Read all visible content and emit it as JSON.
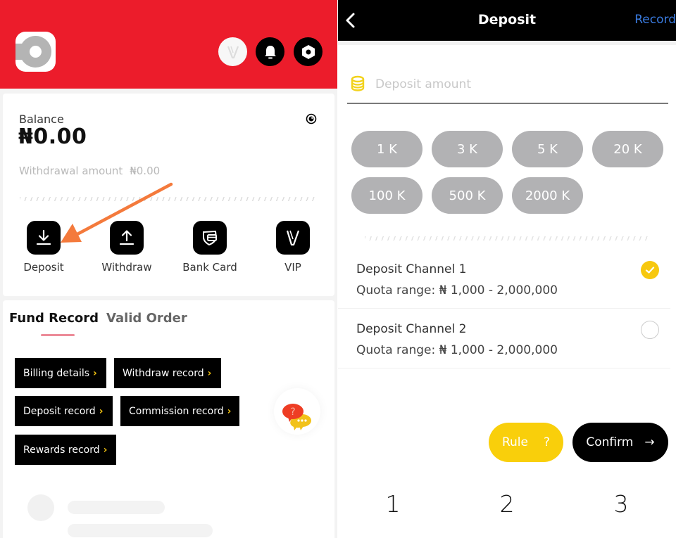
{
  "left_panel": {
    "header": {
      "icons": [
        "app-logo-icon",
        "vip-icon",
        "bell-icon",
        "settings-icon"
      ]
    },
    "balance": {
      "label": "Balance",
      "value": "₦0.00",
      "withdrawal_label": "Withdrawal amount",
      "withdrawal_value": "₦0.00"
    },
    "actions": [
      {
        "label": "Deposit",
        "icon": "download-icon"
      },
      {
        "label": "Withdraw",
        "icon": "upload-icon"
      },
      {
        "label": "Bank Card",
        "icon": "bank-card-icon"
      },
      {
        "label": "VIP",
        "icon": "vip-icon"
      }
    ],
    "annotation": {
      "type": "arrow",
      "color": "#f47a3c",
      "points_to": "Deposit"
    },
    "tabs": [
      {
        "label": "Fund Record",
        "active": true
      },
      {
        "label": "Valid Order",
        "active": false
      }
    ],
    "record_buttons": [
      {
        "label": "Billing details",
        "chevron": "›"
      },
      {
        "label": "Withdraw record",
        "chevron": "›"
      },
      {
        "label": "Deposit record",
        "chevron": "›"
      },
      {
        "label": "Commission record",
        "chevron": "›"
      },
      {
        "label": "Rewards record",
        "chevron": "›"
      }
    ],
    "help_button": {
      "icon": "chat-help-icon",
      "glyph": "?"
    }
  },
  "right_panel": {
    "nav": {
      "back_icon": "‹",
      "title": "Deposit",
      "record_link": "Record"
    },
    "amount_input": {
      "placeholder": "Deposit amount",
      "value": ""
    },
    "quick_amounts": [
      "1 K",
      "3 K",
      "5 K",
      "20 K",
      "100 K",
      "500 K",
      "2000 K"
    ],
    "channels": [
      {
        "name": "Deposit Channel 1",
        "quota": "Quota range: ₦ 1,000 - 2,000,000",
        "selected": true
      },
      {
        "name": "Deposit Channel 2",
        "quota": "Quota range: ₦ 1,000 - 2,000,000",
        "selected": false
      }
    ],
    "buttons": {
      "rule_label": "Rule",
      "rule_icon": "?",
      "confirm_label": "Confirm",
      "confirm_icon": "→"
    },
    "steps": [
      "1",
      "2",
      "3"
    ]
  },
  "colors": {
    "header_red": "#ec1c2b",
    "accent_yellow": "#f9cf0b",
    "link_blue": "#3a7be0",
    "chip_gray": "#b2b2b4",
    "annotation_orange": "#f47a3c"
  }
}
